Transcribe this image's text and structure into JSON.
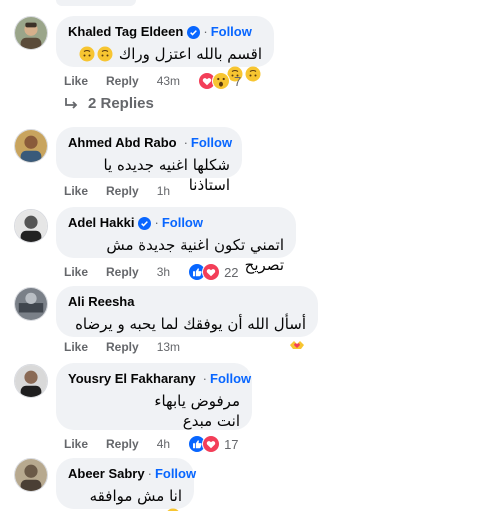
{
  "comments": [
    {
      "author": "Khaled Tag Eldeen",
      "follow": "Follow",
      "text": "اقسم بالله اعتزل وراك",
      "like": "Like",
      "reply": "Reply",
      "time": "43m",
      "reaction_count": "7",
      "reactions": [
        "love",
        "wow"
      ],
      "replies_label": "2 Replies"
    },
    {
      "author": "Ahmed Abd Rabo",
      "follow": "Follow",
      "text": "شكلها اغنيه جديده يا استاذنا",
      "like": "Like",
      "reply": "Reply",
      "time": "1h"
    },
    {
      "author": "Adel Hakki",
      "follow": "Follow",
      "text": "اتمني تكون اغنية جديدة مش تصريح",
      "like": "Like",
      "reply": "Reply",
      "time": "3h",
      "reaction_count": "22",
      "reactions": [
        "like",
        "love"
      ]
    },
    {
      "author": "Ali Reesha",
      "text": "أسأل الله أن يوفقك لما يحبه و يرضاه",
      "like": "Like",
      "reply": "Reply",
      "time": "13m"
    },
    {
      "author": "Yousry El Fakharany",
      "follow": "Follow",
      "text_line1": "مرفوض يابهاء",
      "text_line2": "انت مبدع",
      "like": "Like",
      "reply": "Reply",
      "time": "4h",
      "reaction_count": "17",
      "reactions": [
        "like",
        "love"
      ]
    },
    {
      "author": "Abeer Sabry",
      "follow": "Follow",
      "text": "انا مش موافقه"
    }
  ],
  "colors": {
    "bubble": "#f0f2f5",
    "follow": "#0866ff",
    "meta": "#65676b",
    "verified": "#0866ff"
  }
}
